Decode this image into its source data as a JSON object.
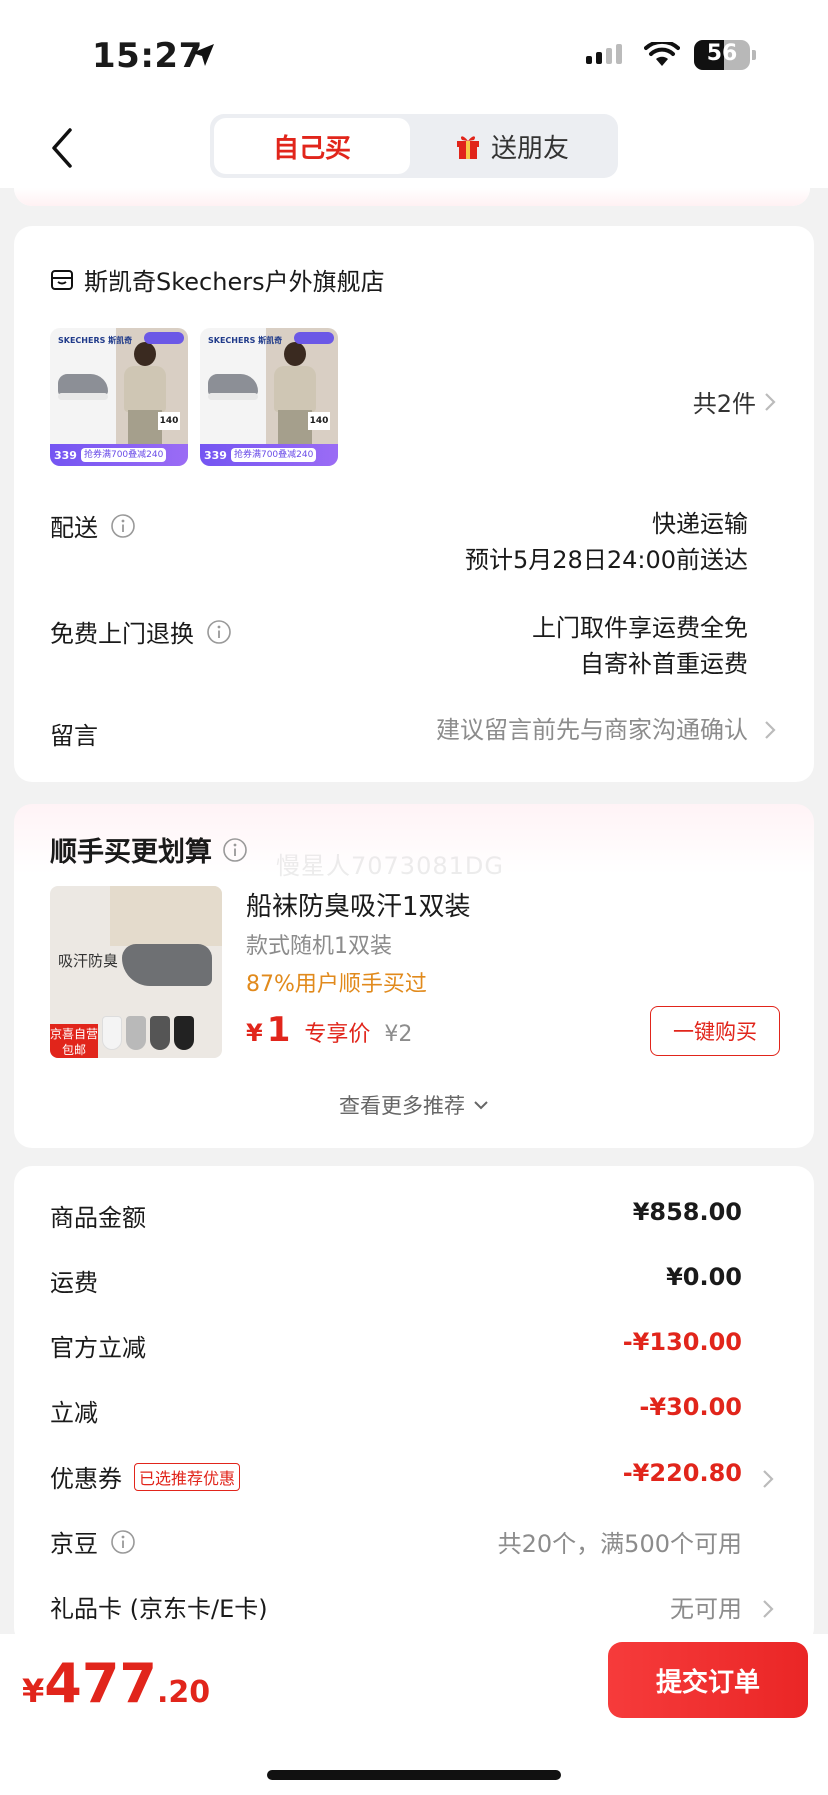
{
  "status_bar": {
    "time": "15:27",
    "battery": "56"
  },
  "nav": {
    "tab_self": "自己买",
    "tab_gift": "送朋友"
  },
  "store": {
    "name": "斯凯奇Skechers户外旗舰店",
    "product_thumbs": [
      {
        "brand": "SKECHERS 斯凯奇",
        "price": "339",
        "promo": "抢券满700叠减240",
        "tag": "140"
      },
      {
        "brand": "SKECHERS 斯凯奇",
        "price": "339",
        "promo": "抢券满700叠减240",
        "tag": "140"
      }
    ],
    "item_count": "共2件",
    "delivery_label": "配送",
    "delivery_method": "快递运输",
    "delivery_eta": "预计5月28日24:00前送达",
    "return_label": "免费上门退换",
    "return_line1": "上门取件享运费全免",
    "return_line2": "自寄补首重运费",
    "remark_label": "留言",
    "remark_placeholder": "建议留言前先与商家沟通确认"
  },
  "recommend": {
    "title": "顺手买更划算",
    "watermark": "慢星人7073081DG",
    "image_text": "吸汗防臭",
    "image_tag_line1": "京喜自营",
    "image_tag_line2": "包邮",
    "name": "船袜防臭吸汗1双装",
    "spec": "款式随机1双装",
    "buyers": "87%用户顺手买过",
    "price_symbol": "¥",
    "price": "1",
    "price_tag": "专享价",
    "original_price": "¥2",
    "buy_button": "一键购买",
    "more": "查看更多推荐"
  },
  "summary": {
    "rows": [
      {
        "label": "商品金额",
        "value": "¥858.00"
      },
      {
        "label": "运费",
        "value": "¥0.00"
      },
      {
        "label": "官方立减",
        "value": "-¥130.00"
      },
      {
        "label": "立减",
        "value": "-¥30.00"
      },
      {
        "label": "优惠券",
        "tag": "已选推荐优惠",
        "value": "-¥220.80"
      },
      {
        "label": "京豆",
        "value": "共20个，满500个可用"
      },
      {
        "label": "礼品卡 (京东卡/E卡)",
        "value": "无可用"
      }
    ]
  },
  "bottom": {
    "yen": "¥",
    "total_int": "477",
    "total_dec": ".20",
    "submit": "提交订单"
  },
  "colors": {
    "accent": "#e1251b",
    "orange": "#e18a1c",
    "background": "#f2f2f2"
  }
}
